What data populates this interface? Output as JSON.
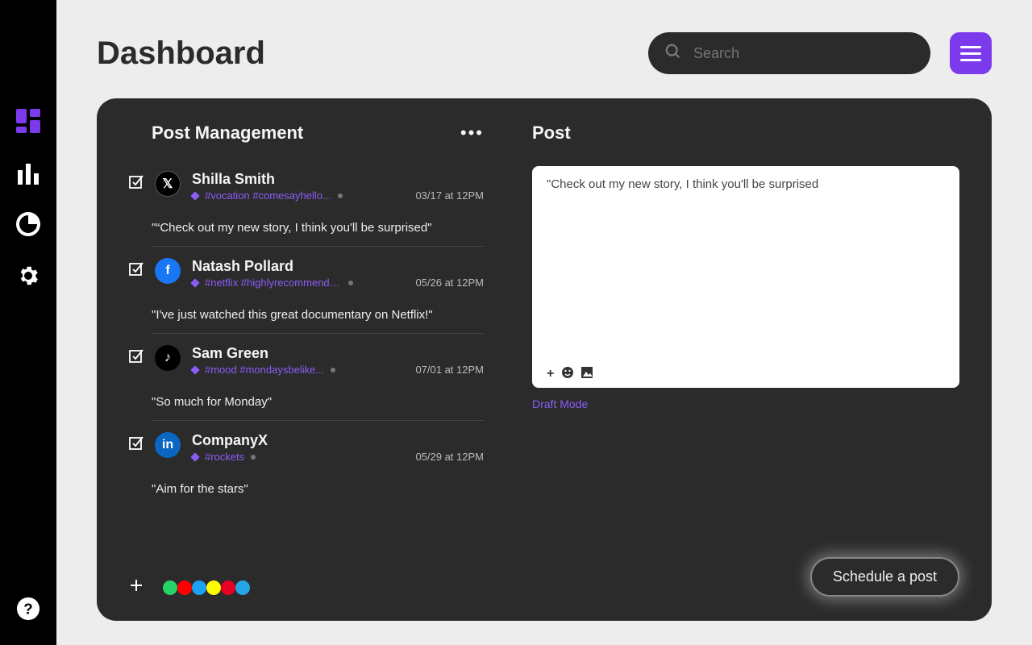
{
  "header": {
    "title": "Dashboard",
    "search_placeholder": "Search"
  },
  "sidebar": {
    "items": [
      "dashboard",
      "analytics",
      "reports",
      "settings"
    ],
    "help": "help"
  },
  "post_mgmt": {
    "title": "Post Management",
    "posts": [
      {
        "name": "Shilla Smith",
        "network": "x",
        "tags": "#vocation #comesayhello...",
        "date": "03/17 at 12PM",
        "body": "\"“Check out my new story, I think you'll be surprised\""
      },
      {
        "name": "Natash Pollard",
        "network": "facebook",
        "tags": "#netflix #highlyrecommended...",
        "date": "05/26 at 12PM",
        "body": "\"I've just watched this great documentary on Netflix!\""
      },
      {
        "name": "Sam Green",
        "network": "tiktok",
        "tags": "#mood #mondaysbelike...",
        "date": "07/01 at 12PM",
        "body": "\"So much for Monday\""
      },
      {
        "name": "CompanyX",
        "network": "linkedin",
        "tags": "#rockets",
        "date": "05/29 at 12PM",
        "body": "\"Aim for the stars\""
      }
    ],
    "add_networks": [
      "whatsapp",
      "youtube",
      "twitter",
      "snapchat",
      "pinterest",
      "telegram"
    ]
  },
  "composer": {
    "title": "Post",
    "text": "\"Check out my new story, I think you'll be surprised",
    "draft_label": "Draft Mode",
    "schedule_label": "Schedule a post"
  },
  "colors": {
    "brand": "#7C3AED",
    "networks": {
      "x": "#000000",
      "facebook": "#1877F2",
      "tiktok": "#000000",
      "linkedin": "#0A66C2",
      "whatsapp": "#25D366",
      "youtube": "#FF0000",
      "twitter": "#1DA1F2",
      "snapchat": "#FFFC00",
      "pinterest": "#E60023",
      "telegram": "#26A5E4"
    }
  }
}
